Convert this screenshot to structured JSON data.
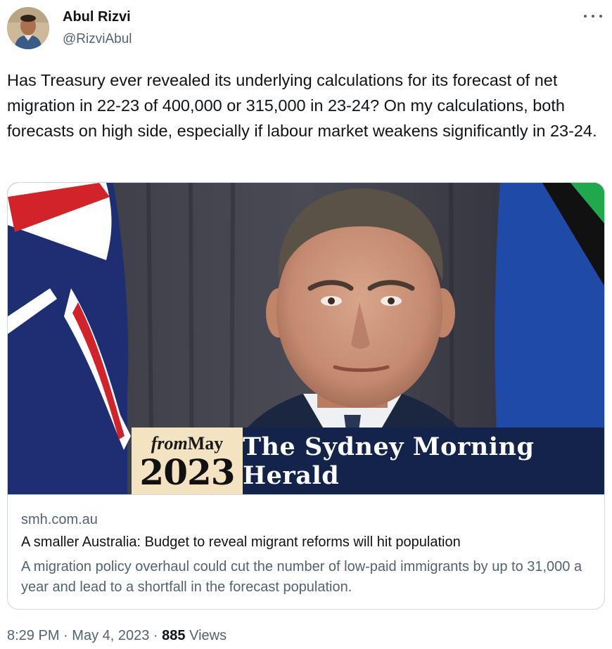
{
  "author": {
    "name": "Abul Rizvi",
    "handle": "@RizviAbul"
  },
  "tweet": {
    "text": "Has Treasury ever revealed its underlying calculations for its forecast of net migration in 22-23 of 400,000 or 315,000 in 23-24? On my calculations, both forecasts on high side, especially if labour market weakens significantly in 23-24."
  },
  "card": {
    "banner_from": "from",
    "banner_month": "May",
    "banner_year": "2023",
    "banner_publication": "The Sydney Morning Herald",
    "domain": "smh.com.au",
    "title": "A smaller Australia: Budget to reveal migrant reforms will hit population",
    "description": "A migration policy overhaul could cut the number of low-paid immigrants by up to 31,000 a year and lead to a shortfall in the forecast population."
  },
  "footer": {
    "time": "8:29 PM",
    "separator": "·",
    "date": "May 4, 2023",
    "views_count": "885",
    "views_label": "Views"
  },
  "colors": {
    "text_primary": "#0f1419",
    "text_secondary": "#536471",
    "border": "#cfd9de",
    "banner_navy": "#13234a",
    "banner_cream": "#f4e3c1"
  },
  "icons": {
    "more": "more-horizontal-icon"
  }
}
